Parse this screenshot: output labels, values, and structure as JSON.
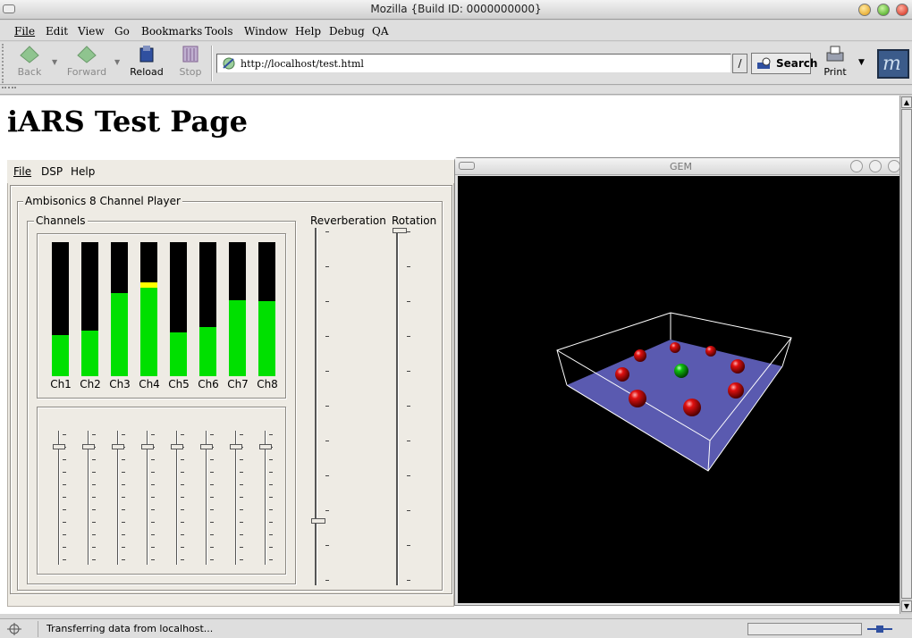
{
  "window": {
    "title": "Mozilla {Build ID: 0000000000}"
  },
  "menubar": {
    "items": [
      "File",
      "Edit",
      "View",
      "Go",
      "Bookmarks",
      "Tools",
      "Window",
      "Help",
      "Debug",
      "QA"
    ]
  },
  "toolbar": {
    "back": "Back",
    "forward": "Forward",
    "reload": "Reload",
    "stop": "Stop",
    "url": "http://localhost/test.html",
    "dropdown_glyph": "/",
    "search": "Search",
    "print": "Print"
  },
  "page": {
    "title": "iARS Test Page"
  },
  "applet": {
    "menu": [
      "File",
      "DSP",
      "Help"
    ],
    "group_title": "Ambisonics 8 Channel Player",
    "channels_title": "Channels",
    "reverb_label": "Reverberation",
    "rotation_label": "Rotation",
    "channels": [
      {
        "label": "Ch1",
        "level": 0.31,
        "peak": null
      },
      {
        "label": "Ch2",
        "level": 0.34,
        "peak": null
      },
      {
        "label": "Ch3",
        "level": 0.62,
        "peak": null
      },
      {
        "label": "Ch4",
        "level": 0.66,
        "peak": 0.7
      },
      {
        "label": "Ch5",
        "level": 0.33,
        "peak": null
      },
      {
        "label": "Ch6",
        "level": 0.37,
        "peak": null
      },
      {
        "label": "Ch7",
        "level": 0.57,
        "peak": null
      },
      {
        "label": "Ch8",
        "level": 0.56,
        "peak": null
      }
    ],
    "fader_levels": [
      0.9,
      0.9,
      0.9,
      0.9,
      0.9,
      0.9,
      0.9,
      0.9
    ],
    "reverb_level": 0.83,
    "rotation_level": 0.0
  },
  "gem": {
    "title": "GEM"
  },
  "status": {
    "text": "Transferring data from localhost..."
  },
  "colors": {
    "meter_fill": "#00e000",
    "meter_peak": "#ffff00",
    "floor": "#5a5ab0",
    "sphere_red": "#e01010",
    "sphere_green": "#10c010"
  }
}
